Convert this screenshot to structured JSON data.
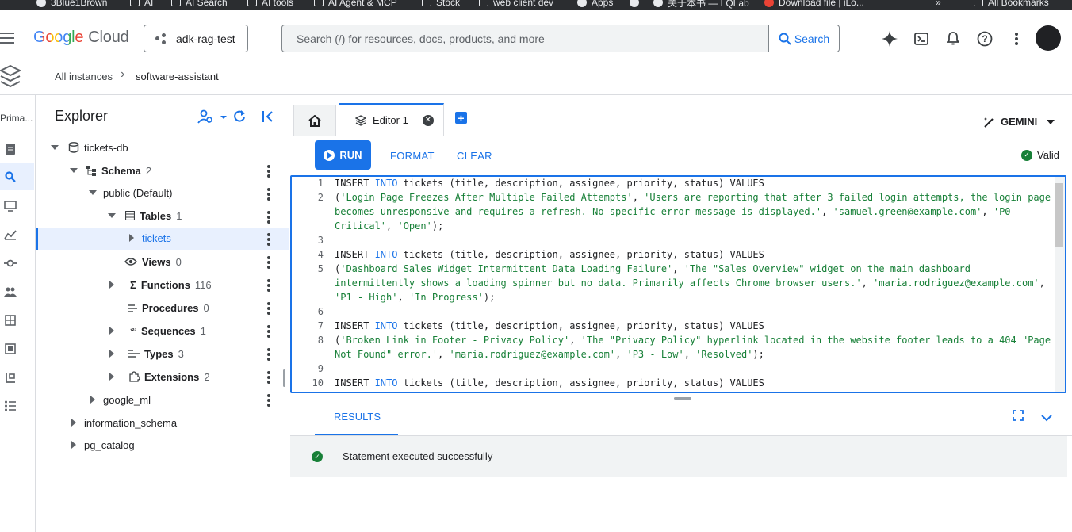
{
  "bookmarks": [
    {
      "label": "3Blue1Brown",
      "icon": "dot-icon"
    },
    {
      "label": "AI",
      "icon": "folder-icon"
    },
    {
      "label": "AI Search",
      "icon": "folder-icon"
    },
    {
      "label": "AI tools",
      "icon": "folder-icon"
    },
    {
      "label": "AI Agent & MCP",
      "icon": "folder-icon"
    },
    {
      "label": "Stock",
      "icon": "folder-icon"
    },
    {
      "label": "web client dev",
      "icon": "folder-icon"
    },
    {
      "label": "Apps",
      "icon": "apps-icon"
    },
    {
      "label": "关于本书 — LQLab",
      "icon": "page-icon"
    },
    {
      "label": "Download file | iLo...",
      "icon": "heart-icon"
    },
    {
      "label": "»",
      "icon": ""
    },
    {
      "label": "All Bookmarks",
      "icon": "folder-icon"
    }
  ],
  "header": {
    "logo_google": "Google",
    "logo_cloud": "Cloud",
    "project": "adk-rag-test",
    "search_placeholder": "Search (/) for resources, docs, products, and more",
    "search_button": "Search"
  },
  "breadcrumb": {
    "parent": "All instances",
    "separator": "›",
    "current": "software-assistant"
  },
  "rail": {
    "label": "Prima..."
  },
  "explorer": {
    "title": "Explorer",
    "tree": [
      {
        "label": "tickets-db",
        "count": ""
      },
      {
        "label": "Schema",
        "count": "2"
      },
      {
        "label": "public (Default)",
        "count": ""
      },
      {
        "label": "Tables",
        "count": "1"
      },
      {
        "label": "tickets",
        "count": ""
      },
      {
        "label": "Views",
        "count": "0"
      },
      {
        "label": "Functions",
        "count": "116"
      },
      {
        "label": "Procedures",
        "count": "0"
      },
      {
        "label": "Sequences",
        "count": "1"
      },
      {
        "label": "Types",
        "count": "3"
      },
      {
        "label": "Extensions",
        "count": "2"
      },
      {
        "label": "google_ml",
        "count": ""
      },
      {
        "label": "information_schema",
        "count": ""
      },
      {
        "label": "pg_catalog",
        "count": ""
      }
    ]
  },
  "editor": {
    "tab_label": "Editor 1",
    "gemini_label": "GEMINI",
    "run_label": "RUN",
    "format_label": "FORMAT",
    "clear_label": "CLEAR",
    "valid_label": "Valid",
    "lines": [
      {
        "n": "1",
        "segs": [
          [
            "kw0",
            "INSERT "
          ],
          [
            "kw",
            "INTO"
          ],
          [
            "p",
            " tickets ("
          ],
          [
            "p",
            "title, description, assignee, priority, status) VALUES"
          ]
        ]
      },
      {
        "n": "2",
        "segs": [
          [
            "p",
            "("
          ],
          [
            "s",
            "'Login Page Freezes After Multiple Failed Attempts'"
          ],
          [
            "p",
            ", "
          ],
          [
            "s",
            "'Users are reporting that after 3 failed login attempts, the login page"
          ]
        ]
      },
      {
        "n": "",
        "segs": [
          [
            "s",
            "becomes unresponsive and requires a refresh. No specific error message is displayed.'"
          ],
          [
            "p",
            ", "
          ],
          [
            "s",
            "'samuel.green@example.com'"
          ],
          [
            "p",
            ", "
          ],
          [
            "s",
            "'P0 -"
          ]
        ]
      },
      {
        "n": "",
        "segs": [
          [
            "s",
            "Critical'"
          ],
          [
            "p",
            ", "
          ],
          [
            "s",
            "'Open'"
          ],
          [
            "p",
            ");"
          ]
        ]
      },
      {
        "n": "3",
        "segs": []
      },
      {
        "n": "4",
        "segs": [
          [
            "kw0",
            "INSERT "
          ],
          [
            "kw",
            "INTO"
          ],
          [
            "p",
            " tickets ("
          ],
          [
            "p",
            "title, description, assignee, priority, status) VALUES"
          ]
        ]
      },
      {
        "n": "5",
        "segs": [
          [
            "p",
            "("
          ],
          [
            "s",
            "'Dashboard Sales Widget Intermittent Data Loading Failure'"
          ],
          [
            "p",
            ", "
          ],
          [
            "s",
            "'The \"Sales Overview\" widget on the main dashboard"
          ]
        ]
      },
      {
        "n": "",
        "segs": [
          [
            "s",
            "intermittently shows a loading spinner but no data. Primarily affects Chrome browser users.'"
          ],
          [
            "p",
            ", "
          ],
          [
            "s",
            "'maria.rodriguez@example.com'"
          ],
          [
            "p",
            ","
          ]
        ]
      },
      {
        "n": "",
        "segs": [
          [
            "s",
            "'P1 - High'"
          ],
          [
            "p",
            ", "
          ],
          [
            "s",
            "'In Progress'"
          ],
          [
            "p",
            ");"
          ]
        ]
      },
      {
        "n": "6",
        "segs": []
      },
      {
        "n": "7",
        "segs": [
          [
            "kw0",
            "INSERT "
          ],
          [
            "kw",
            "INTO"
          ],
          [
            "p",
            " tickets ("
          ],
          [
            "p",
            "title, description, assignee, priority, status) VALUES"
          ]
        ]
      },
      {
        "n": "8",
        "segs": [
          [
            "p",
            "("
          ],
          [
            "s",
            "'Broken Link in Footer - Privacy Policy'"
          ],
          [
            "p",
            ", "
          ],
          [
            "s",
            "'The \"Privacy Policy\" hyperlink located in the website footer leads to a 404 \"Page"
          ]
        ]
      },
      {
        "n": "",
        "segs": [
          [
            "s",
            "Not Found\" error.'"
          ],
          [
            "p",
            ", "
          ],
          [
            "s",
            "'maria.rodriguez@example.com'"
          ],
          [
            "p",
            ", "
          ],
          [
            "s",
            "'P3 - Low'"
          ],
          [
            "p",
            ", "
          ],
          [
            "s",
            "'Resolved'"
          ],
          [
            "p",
            ");"
          ]
        ]
      },
      {
        "n": "9",
        "segs": []
      },
      {
        "n": "10",
        "segs": [
          [
            "kw0",
            "INSERT "
          ],
          [
            "kw",
            "INTO"
          ],
          [
            "p",
            " tickets ("
          ],
          [
            "p",
            "title, description, assignee, priority, status) VALUES"
          ]
        ]
      }
    ]
  },
  "results": {
    "tab_label": "RESULTS",
    "message": "Statement executed successfully"
  },
  "colors": {
    "accent": "#1a73e8",
    "success": "#188038",
    "selection_bg": "#e8f0fe"
  }
}
